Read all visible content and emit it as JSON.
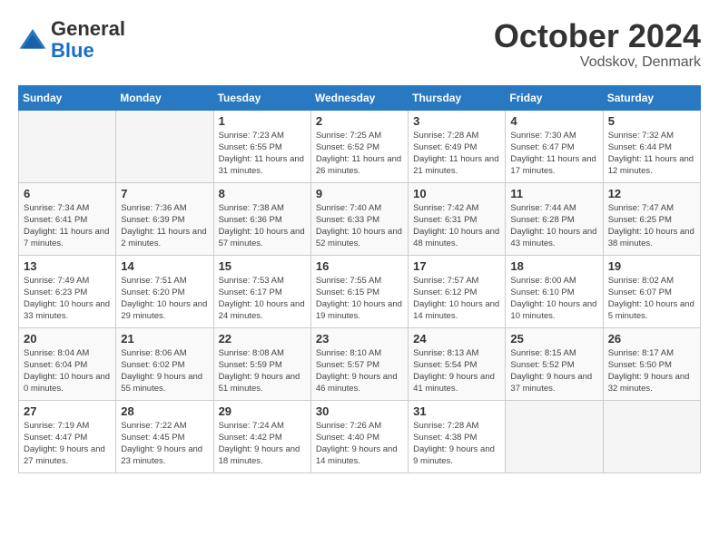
{
  "header": {
    "logo_line1": "General",
    "logo_line2": "Blue",
    "month": "October 2024",
    "location": "Vodskov, Denmark"
  },
  "days_of_week": [
    "Sunday",
    "Monday",
    "Tuesday",
    "Wednesday",
    "Thursday",
    "Friday",
    "Saturday"
  ],
  "weeks": [
    [
      {
        "num": "",
        "info": ""
      },
      {
        "num": "",
        "info": ""
      },
      {
        "num": "1",
        "info": "Sunrise: 7:23 AM\nSunset: 6:55 PM\nDaylight: 11 hours and 31 minutes."
      },
      {
        "num": "2",
        "info": "Sunrise: 7:25 AM\nSunset: 6:52 PM\nDaylight: 11 hours and 26 minutes."
      },
      {
        "num": "3",
        "info": "Sunrise: 7:28 AM\nSunset: 6:49 PM\nDaylight: 11 hours and 21 minutes."
      },
      {
        "num": "4",
        "info": "Sunrise: 7:30 AM\nSunset: 6:47 PM\nDaylight: 11 hours and 17 minutes."
      },
      {
        "num": "5",
        "info": "Sunrise: 7:32 AM\nSunset: 6:44 PM\nDaylight: 11 hours and 12 minutes."
      }
    ],
    [
      {
        "num": "6",
        "info": "Sunrise: 7:34 AM\nSunset: 6:41 PM\nDaylight: 11 hours and 7 minutes."
      },
      {
        "num": "7",
        "info": "Sunrise: 7:36 AM\nSunset: 6:39 PM\nDaylight: 11 hours and 2 minutes."
      },
      {
        "num": "8",
        "info": "Sunrise: 7:38 AM\nSunset: 6:36 PM\nDaylight: 10 hours and 57 minutes."
      },
      {
        "num": "9",
        "info": "Sunrise: 7:40 AM\nSunset: 6:33 PM\nDaylight: 10 hours and 52 minutes."
      },
      {
        "num": "10",
        "info": "Sunrise: 7:42 AM\nSunset: 6:31 PM\nDaylight: 10 hours and 48 minutes."
      },
      {
        "num": "11",
        "info": "Sunrise: 7:44 AM\nSunset: 6:28 PM\nDaylight: 10 hours and 43 minutes."
      },
      {
        "num": "12",
        "info": "Sunrise: 7:47 AM\nSunset: 6:25 PM\nDaylight: 10 hours and 38 minutes."
      }
    ],
    [
      {
        "num": "13",
        "info": "Sunrise: 7:49 AM\nSunset: 6:23 PM\nDaylight: 10 hours and 33 minutes."
      },
      {
        "num": "14",
        "info": "Sunrise: 7:51 AM\nSunset: 6:20 PM\nDaylight: 10 hours and 29 minutes."
      },
      {
        "num": "15",
        "info": "Sunrise: 7:53 AM\nSunset: 6:17 PM\nDaylight: 10 hours and 24 minutes."
      },
      {
        "num": "16",
        "info": "Sunrise: 7:55 AM\nSunset: 6:15 PM\nDaylight: 10 hours and 19 minutes."
      },
      {
        "num": "17",
        "info": "Sunrise: 7:57 AM\nSunset: 6:12 PM\nDaylight: 10 hours and 14 minutes."
      },
      {
        "num": "18",
        "info": "Sunrise: 8:00 AM\nSunset: 6:10 PM\nDaylight: 10 hours and 10 minutes."
      },
      {
        "num": "19",
        "info": "Sunrise: 8:02 AM\nSunset: 6:07 PM\nDaylight: 10 hours and 5 minutes."
      }
    ],
    [
      {
        "num": "20",
        "info": "Sunrise: 8:04 AM\nSunset: 6:04 PM\nDaylight: 10 hours and 0 minutes."
      },
      {
        "num": "21",
        "info": "Sunrise: 8:06 AM\nSunset: 6:02 PM\nDaylight: 9 hours and 55 minutes."
      },
      {
        "num": "22",
        "info": "Sunrise: 8:08 AM\nSunset: 5:59 PM\nDaylight: 9 hours and 51 minutes."
      },
      {
        "num": "23",
        "info": "Sunrise: 8:10 AM\nSunset: 5:57 PM\nDaylight: 9 hours and 46 minutes."
      },
      {
        "num": "24",
        "info": "Sunrise: 8:13 AM\nSunset: 5:54 PM\nDaylight: 9 hours and 41 minutes."
      },
      {
        "num": "25",
        "info": "Sunrise: 8:15 AM\nSunset: 5:52 PM\nDaylight: 9 hours and 37 minutes."
      },
      {
        "num": "26",
        "info": "Sunrise: 8:17 AM\nSunset: 5:50 PM\nDaylight: 9 hours and 32 minutes."
      }
    ],
    [
      {
        "num": "27",
        "info": "Sunrise: 7:19 AM\nSunset: 4:47 PM\nDaylight: 9 hours and 27 minutes."
      },
      {
        "num": "28",
        "info": "Sunrise: 7:22 AM\nSunset: 4:45 PM\nDaylight: 9 hours and 23 minutes."
      },
      {
        "num": "29",
        "info": "Sunrise: 7:24 AM\nSunset: 4:42 PM\nDaylight: 9 hours and 18 minutes."
      },
      {
        "num": "30",
        "info": "Sunrise: 7:26 AM\nSunset: 4:40 PM\nDaylight: 9 hours and 14 minutes."
      },
      {
        "num": "31",
        "info": "Sunrise: 7:28 AM\nSunset: 4:38 PM\nDaylight: 9 hours and 9 minutes."
      },
      {
        "num": "",
        "info": ""
      },
      {
        "num": "",
        "info": ""
      }
    ]
  ]
}
